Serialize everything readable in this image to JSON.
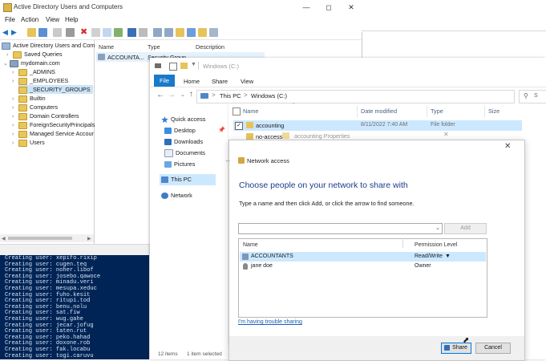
{
  "ad_window": {
    "title": "Active Directory Users and Computers",
    "menu": [
      "File",
      "Action",
      "View",
      "Help"
    ],
    "tree": {
      "root": "Active Directory Users and Com",
      "saved_queries": "Saved Queries",
      "domain": "mydomain.com",
      "children": [
        "_ADMINS",
        "_EMPLOYEES",
        "_SECURITY_GROUPS",
        "Builtin",
        "Computers",
        "Domain Controllers",
        "ForeignSecurityPrincipals",
        "Managed Service Accour",
        "Users"
      ]
    },
    "columns": {
      "name": "Name",
      "type": "Type",
      "description": "Description"
    },
    "row": {
      "name": "ACCOUNTA...",
      "type": "Security Group..."
    }
  },
  "terminal": {
    "lines": [
      "Creating user: xepifo.rixip",
      "Creating user: cugen.teq",
      "Creating user: noher.libof",
      "Creating user: josebo.qawoce",
      "Creating user: minadu.veri",
      "Creating user: mesupa.xeduc",
      "Creating user: fuho.kesit",
      "Creating user: ritupi.tod",
      "Creating user: benu.nolu",
      "Creating user: sat.fiw",
      "Creating user: wug.gahe",
      "Creating user: jecar.jofug",
      "Creating user: taten.rut",
      "Creating user: peko.hahad",
      "Creating user: doxone.rob",
      "Creating user: fak.locabu",
      "Creating user: togi.caruvu"
    ]
  },
  "explorer": {
    "title": "Windows (C:)",
    "tabs": {
      "file": "File",
      "home": "Home",
      "share": "Share",
      "view": "View"
    },
    "breadcrumb": {
      "pc": "This PC",
      "sep": ">",
      "drive": "Windows (C:)"
    },
    "search_placeholder": "S",
    "nav": {
      "quick_access": "Quick access",
      "desktop": "Desktop",
      "downloads": "Downloads",
      "documents": "Documents",
      "pictures": "Pictures",
      "this_pc": "This PC",
      "network": "Network"
    },
    "columns": {
      "name": "Name",
      "date_modified": "Date modified",
      "type": "Type",
      "size": "Size"
    },
    "rows": [
      {
        "name": "accounting",
        "date": "8/11/2022 7:40 AM",
        "type": "File folder"
      },
      {
        "name": "no-access"
      }
    ],
    "ghost_title": "accounting Properties",
    "status": {
      "items": "12 items",
      "selected": "1 item selected"
    }
  },
  "dialog": {
    "title": "Network access",
    "heading": "Choose people on your network to share with",
    "instructions": "Type a name and then click Add, or click the arrow to find someone.",
    "add_label": "Add",
    "columns": {
      "name": "Name",
      "permission": "Permission Level"
    },
    "rows": [
      {
        "name": "ACCOUNTANTS",
        "permission": "Read/Write"
      },
      {
        "name": "jane doe",
        "permission": "Owner"
      }
    ],
    "trouble_link": "I'm having trouble sharing",
    "share_label": "Share",
    "cancel_label": "Cancel"
  },
  "colors": {
    "terminal_bg": "#012456",
    "file_tab": "#1979ca",
    "selection": "#cce8ff",
    "heading": "#1c3a8c"
  }
}
